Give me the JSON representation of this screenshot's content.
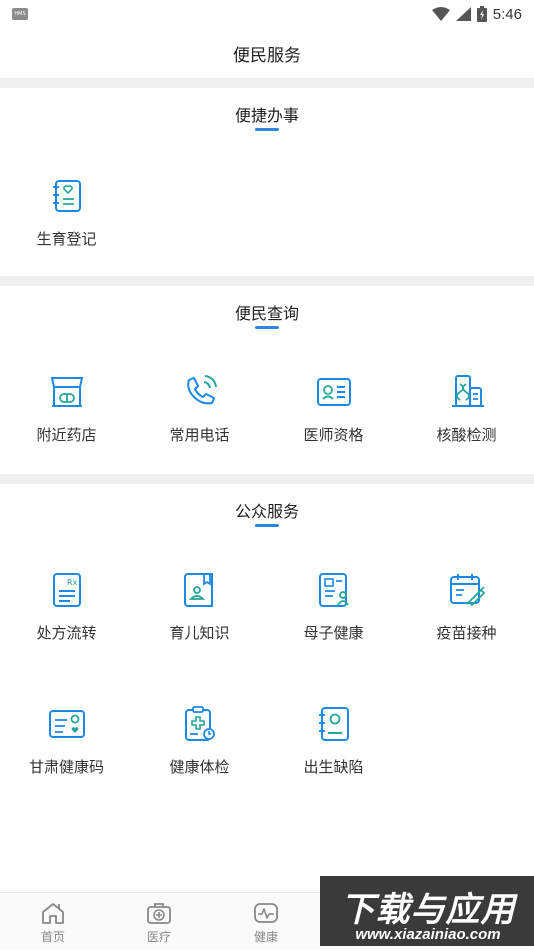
{
  "status_bar": {
    "sim_label": "HMS",
    "time": "5:46",
    "icons": [
      "wifi-icon",
      "signal-icon",
      "battery-icon"
    ]
  },
  "header": {
    "title": "便民服务"
  },
  "colors": {
    "accent": "#2e86de",
    "icon_blue": "#1e88e5",
    "icon_teal": "#26a69a"
  },
  "sections": [
    {
      "title": "便捷办事",
      "items": [
        {
          "label": "生育登记",
          "icon": "birth-registration-icon"
        }
      ]
    },
    {
      "title": "便民查询",
      "items": [
        {
          "label": "附近药店",
          "icon": "pharmacy-store-icon"
        },
        {
          "label": "常用电话",
          "icon": "phone-icon"
        },
        {
          "label": "医师资格",
          "icon": "doctor-license-icon"
        },
        {
          "label": "核酸检测",
          "icon": "nucleic-test-icon"
        }
      ]
    },
    {
      "title": "公众服务",
      "items": [
        {
          "label": "处方流转",
          "icon": "prescription-icon"
        },
        {
          "label": "育儿知识",
          "icon": "parenting-book-icon"
        },
        {
          "label": "母子健康",
          "icon": "mother-child-health-icon"
        },
        {
          "label": "疫苗接种",
          "icon": "vaccine-icon"
        },
        {
          "label": "甘肃健康码",
          "icon": "health-code-card-icon"
        },
        {
          "label": "健康体检",
          "icon": "health-checkup-icon"
        },
        {
          "label": "出生缺陷",
          "icon": "birth-defect-icon"
        }
      ]
    }
  ],
  "tabbar": {
    "tabs": [
      {
        "label": "首页",
        "icon": "home-icon"
      },
      {
        "label": "医疗",
        "icon": "medical-kit-icon"
      },
      {
        "label": "健康",
        "icon": "heartbeat-icon"
      }
    ]
  },
  "watermark": {
    "text": "下载与应用",
    "url": "www.xiazainiao.com"
  }
}
